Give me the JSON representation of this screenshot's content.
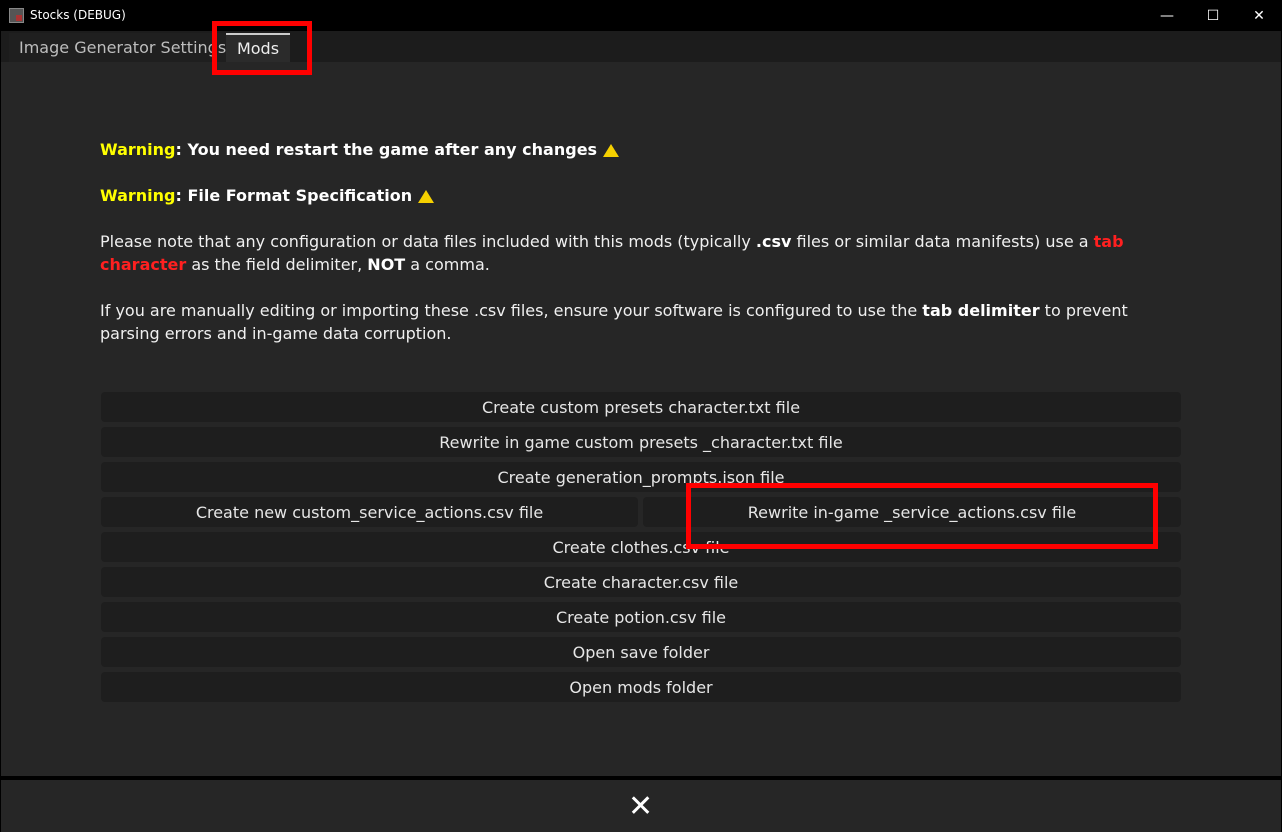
{
  "window": {
    "title": "Stocks (DEBUG)",
    "minimize": "—",
    "maximize": "☐",
    "close": "✕"
  },
  "tabs": [
    {
      "label": "Image Generator Settings"
    },
    {
      "label": "Mods"
    }
  ],
  "warnings": [
    {
      "prefix": "Warning",
      "text": ": You need restart the game after any changes"
    },
    {
      "prefix": "Warning",
      "text": ": File Format Specification"
    }
  ],
  "note1": {
    "a": "Please note that any configuration or data files included with this mods (typically ",
    "b": ".csv",
    "c": " files or similar data manifests) use a ",
    "d": "tab character",
    "e": " as the field delimiter, ",
    "f": "NOT",
    "g": " a comma."
  },
  "note2": {
    "a": "If you are manually editing or importing these .csv files, ensure your software is configured to use the ",
    "b": "tab delimiter",
    "c": " to prevent parsing errors and in-game data corruption."
  },
  "buttons": {
    "create_presets": "Create custom presets character.txt file",
    "rewrite_presets": "Rewrite in game custom presets _character.txt file",
    "create_prompts": "Create generation_prompts.json file",
    "create_service": "Create new custom_service_actions.csv file",
    "rewrite_service": "Rewrite in-game _service_actions.csv file",
    "create_clothes": "Create clothes.csv file",
    "create_character": "Create character.csv file",
    "create_potion": "Create potion.csv file",
    "open_save": "Open save folder",
    "open_mods": "Open mods folder"
  },
  "footer": {
    "close": "✕"
  },
  "colors": {
    "warning": "#ffff00",
    "highlight": "#ff2020",
    "annotation": "#ff0000"
  }
}
